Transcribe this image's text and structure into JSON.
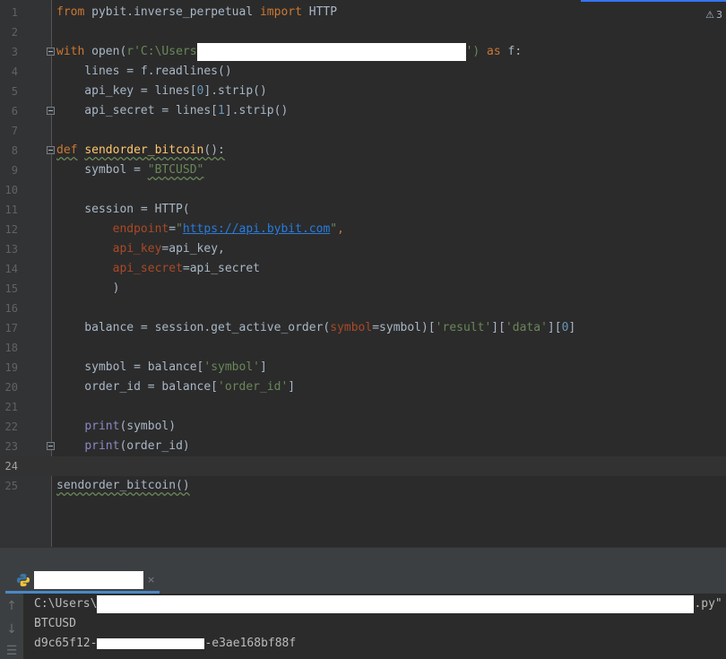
{
  "editor": {
    "warning_count": "3",
    "lines": [
      {
        "n": "1"
      },
      {
        "n": "2"
      },
      {
        "n": "3"
      },
      {
        "n": "4"
      },
      {
        "n": "5"
      },
      {
        "n": "6"
      },
      {
        "n": "7"
      },
      {
        "n": "8"
      },
      {
        "n": "9"
      },
      {
        "n": "10"
      },
      {
        "n": "11"
      },
      {
        "n": "12"
      },
      {
        "n": "13"
      },
      {
        "n": "14"
      },
      {
        "n": "15"
      },
      {
        "n": "16"
      },
      {
        "n": "17"
      },
      {
        "n": "18"
      },
      {
        "n": "19"
      },
      {
        "n": "20"
      },
      {
        "n": "21"
      },
      {
        "n": "22"
      },
      {
        "n": "23"
      },
      {
        "n": "24"
      },
      {
        "n": "25"
      }
    ],
    "code": {
      "l1": {
        "from": "from",
        "module": " pybit.inverse_perpetual ",
        "import": "import",
        "name": " HTTP"
      },
      "l3": {
        "with": "with",
        "open": " open(",
        "str_start": "r'C:\\Users",
        "str_end": "')",
        "as": " as",
        "f": " f:"
      },
      "l4": {
        "text": "    lines = f.readlines()"
      },
      "l5": {
        "pre": "    api_key = lines[",
        "idx": "0",
        "post": "].strip()"
      },
      "l6": {
        "pre": "    api_secret = lines[",
        "idx": "1",
        "post": "].strip()"
      },
      "l8": {
        "def": "def",
        "name": "sendorder_bitcoin",
        "post": "():"
      },
      "l9": {
        "pre": "    symbol = ",
        "str": "\"BTCUSD\""
      },
      "l11": {
        "text": "    session = HTTP("
      },
      "l12": {
        "indent": "        ",
        "param": "endpoint",
        "eq": "=",
        "q1": "\"",
        "url": "https://api.bybit.com",
        "q2": "\"",
        "comma": ","
      },
      "l13": {
        "indent": "        ",
        "param": "api_key",
        "rest": "=api_key,"
      },
      "l14": {
        "indent": "        ",
        "param": "api_secret",
        "rest": "=api_secret"
      },
      "l15": {
        "text": "        )"
      },
      "l17": {
        "pre": "    balance = session.get_active_order(",
        "param": "symbol",
        "mid": "=symbol)[",
        "s1": "'result'",
        "b1": "][",
        "s2": "'data'",
        "b2": "][",
        "idx": "0",
        "end": "]"
      },
      "l19": {
        "pre": "    symbol = balance[",
        "str": "'symbol'",
        "end": "]"
      },
      "l20": {
        "pre": "    order_id = balance[",
        "str": "'order_id'",
        "end": "]"
      },
      "l22": {
        "indent": "    ",
        "fn": "print",
        "rest": "(symbol)"
      },
      "l23": {
        "indent": "    ",
        "fn": "print",
        "rest": "(order_id)"
      },
      "l25": {
        "text": "sendorder_bitcoin()"
      }
    }
  },
  "run_panel": {
    "tab_close": "×",
    "output": {
      "line1_start": "C:\\Users\\",
      "line1_end": ".py\"",
      "line2": "BTCUSD",
      "line3_start": "d9c65f12-",
      "line3_end": "-e3ae168bf88f"
    }
  },
  "icons": {
    "warning": "⚠",
    "up": "↑",
    "down": "↓",
    "wrap": "☰"
  },
  "colors": {
    "keyword": "#cc7832",
    "function": "#ffc66d",
    "string": "#6a8759",
    "number": "#6897bb",
    "param": "#aa4926",
    "builtin": "#8888c6"
  }
}
